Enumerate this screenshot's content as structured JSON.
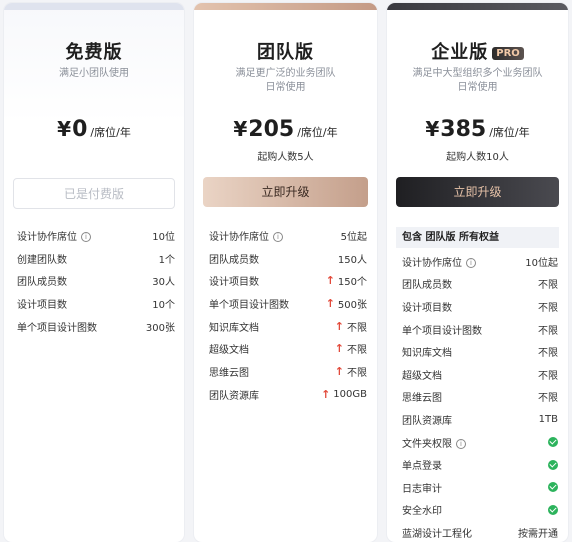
{
  "free": {
    "title": "免费版",
    "subtitle": "满足小团队使用",
    "currency": "¥",
    "price": "0",
    "unit": "/席位/年",
    "button": "已是付费版",
    "features": [
      {
        "label": "设计协作席位",
        "value": "10位",
        "info": true
      },
      {
        "label": "创建团队数",
        "value": "1个"
      },
      {
        "label": "团队成员数",
        "value": "30人"
      },
      {
        "label": "设计项目数",
        "value": "10个"
      },
      {
        "label": "单个项目设计图数",
        "value": "300张"
      }
    ]
  },
  "team": {
    "title": "团队版",
    "subtitle_line1": "满足更广泛的业务团队",
    "subtitle_line2": "日常使用",
    "currency": "¥",
    "price": "205",
    "unit": "/席位/年",
    "min_buy": "起购人数5人",
    "button": "立即升级",
    "features": [
      {
        "label": "设计协作席位",
        "value": "5位起",
        "info": true
      },
      {
        "label": "团队成员数",
        "value": "150人"
      },
      {
        "label": "设计项目数",
        "value": "150个",
        "up": true
      },
      {
        "label": "单个项目设计图数",
        "value": "500张",
        "up": true
      },
      {
        "label": "知识库文档",
        "value": "不限",
        "up": true
      },
      {
        "label": "超级文档",
        "value": "不限",
        "up": true
      },
      {
        "label": "思维云图",
        "value": "不限",
        "up": true
      },
      {
        "label": "团队资源库",
        "value": "100GB",
        "up": true
      }
    ]
  },
  "enterprise": {
    "title": "企业版",
    "badge": "PRO",
    "subtitle_line1": "满足中大型组织多个业务团队",
    "subtitle_line2": "日常使用",
    "currency": "¥",
    "price": "385",
    "unit": "/席位/年",
    "min_buy": "起购人数10人",
    "button": "立即升级",
    "includes": "包含 团队版 所有权益",
    "features": [
      {
        "label": "设计协作席位",
        "value": "10位起",
        "info": true
      },
      {
        "label": "团队成员数",
        "value": "不限"
      },
      {
        "label": "设计项目数",
        "value": "不限"
      },
      {
        "label": "单个项目设计图数",
        "value": "不限"
      },
      {
        "label": "知识库文档",
        "value": "不限"
      },
      {
        "label": "超级文档",
        "value": "不限"
      },
      {
        "label": "思维云图",
        "value": "不限"
      },
      {
        "label": "团队资源库",
        "value": "1TB"
      },
      {
        "label": "文件夹权限",
        "value": "",
        "info": true,
        "check": true
      },
      {
        "label": "单点登录",
        "value": "",
        "check": true
      },
      {
        "label": "日志审计",
        "value": "",
        "check": true
      },
      {
        "label": "安全水印",
        "value": "",
        "check": true
      },
      {
        "label": "蓝湖设计工程化",
        "value": "按需开通"
      }
    ]
  },
  "colors": {
    "check": "#2cb35c",
    "up_arrow": "#e24a3b",
    "team_accent": "#c49f8b",
    "enterprise_accent": "#2d2b2b"
  },
  "icons": {
    "info": "info-circle-icon",
    "up": "arrow-up-icon",
    "check": "check-circle-icon"
  }
}
